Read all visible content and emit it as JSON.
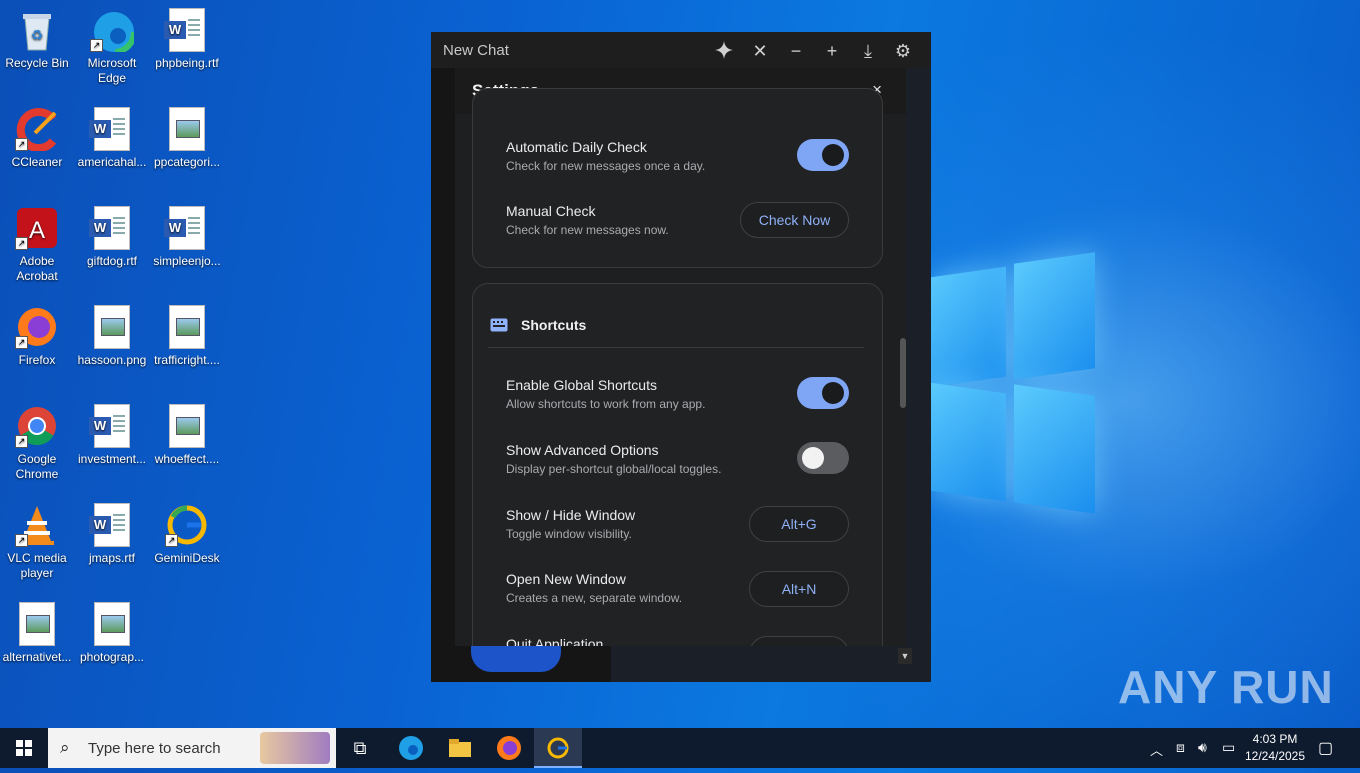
{
  "desktop": {
    "icons": [
      {
        "label": "Recycle Bin"
      },
      {
        "label": "Microsoft Edge"
      },
      {
        "label": "phpbeing.rtf"
      },
      {
        "label": "CCleaner"
      },
      {
        "label": "americahal..."
      },
      {
        "label": "ppcategori..."
      },
      {
        "label": "Adobe Acrobat"
      },
      {
        "label": "giftdog.rtf"
      },
      {
        "label": "simpleenjo..."
      },
      {
        "label": "Firefox"
      },
      {
        "label": "hassoon.png"
      },
      {
        "label": "trafficright...."
      },
      {
        "label": "Google Chrome"
      },
      {
        "label": "investment..."
      },
      {
        "label": "whoeffect...."
      },
      {
        "label": "VLC media player"
      },
      {
        "label": "jmaps.rtf"
      },
      {
        "label": "GeminiDesk"
      },
      {
        "label": "alternativet..."
      },
      {
        "label": "photograp..."
      }
    ]
  },
  "app": {
    "title": "New Chat",
    "titlebar_icons": [
      "sparkle-icon",
      "close-icon",
      "minimize-icon",
      "plus-icon",
      "download-icon",
      "gear-icon"
    ],
    "accent": "#7fa6f5"
  },
  "settings": {
    "title": "Settings",
    "close_glyph": "×",
    "auto_check": {
      "title": "Automatic Daily Check",
      "desc": "Check for new messages once a day.",
      "enabled": true
    },
    "manual_check": {
      "title": "Manual Check",
      "desc": "Check for new messages now.",
      "button": "Check Now"
    },
    "shortcuts": {
      "section_title": "Shortcuts",
      "global": {
        "title": "Enable Global Shortcuts",
        "desc": "Allow shortcuts to work from any app.",
        "enabled": true
      },
      "advanced": {
        "title": "Show Advanced Options",
        "desc": "Display per-shortcut global/local toggles.",
        "enabled": false
      },
      "show_hide": {
        "title": "Show / Hide Window",
        "desc": "Toggle window visibility.",
        "key": "Alt+G"
      },
      "new_window": {
        "title": "Open New Window",
        "desc": "Creates a new, separate window.",
        "key": "Alt+N"
      },
      "quit": {
        "title": "Quit Application"
      }
    }
  },
  "taskbar": {
    "search_placeholder": "Type here to search",
    "time": "4:03 PM",
    "date": "12/24/2025"
  },
  "watermark": "ANY RUN"
}
